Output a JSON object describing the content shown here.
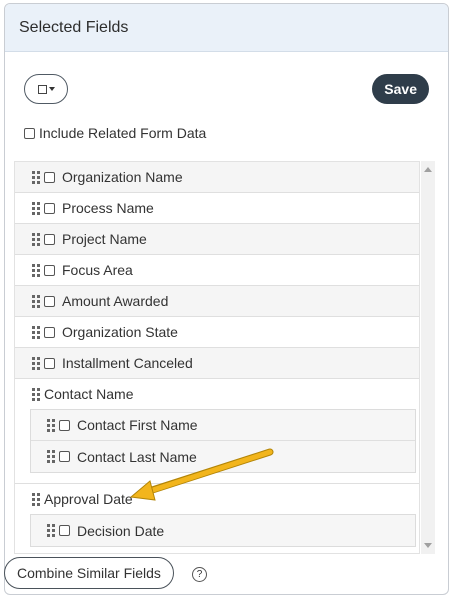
{
  "panel": {
    "title": "Selected Fields"
  },
  "toolbar": {
    "select_icon": "checkbox-dropdown-icon",
    "save_label": "Save"
  },
  "include_related": {
    "label": "Include Related Form Data",
    "checked": false
  },
  "fields": [
    {
      "label": "Organization Name",
      "checked": false
    },
    {
      "label": "Process Name",
      "checked": false
    },
    {
      "label": "Project Name",
      "checked": false
    },
    {
      "label": "Focus Area",
      "checked": false
    },
    {
      "label": "Amount Awarded",
      "checked": false
    },
    {
      "label": "Organization State",
      "checked": false
    },
    {
      "label": "Installment Canceled",
      "checked": false
    }
  ],
  "groups": [
    {
      "label": "Contact Name",
      "children": [
        {
          "label": "Contact First Name",
          "checked": false
        },
        {
          "label": "Contact Last Name",
          "checked": false
        }
      ]
    },
    {
      "label": "Approval Date",
      "children": [
        {
          "label": "Decision Date",
          "checked": false
        }
      ]
    }
  ],
  "footer": {
    "combine_label": "Combine Similar Fields",
    "help_icon": "help-circle-icon",
    "help_glyph": "?"
  },
  "colors": {
    "header_bg": "#eaf1f9",
    "save_bg": "#2f3d4a",
    "arrow": "#f2b51c"
  }
}
